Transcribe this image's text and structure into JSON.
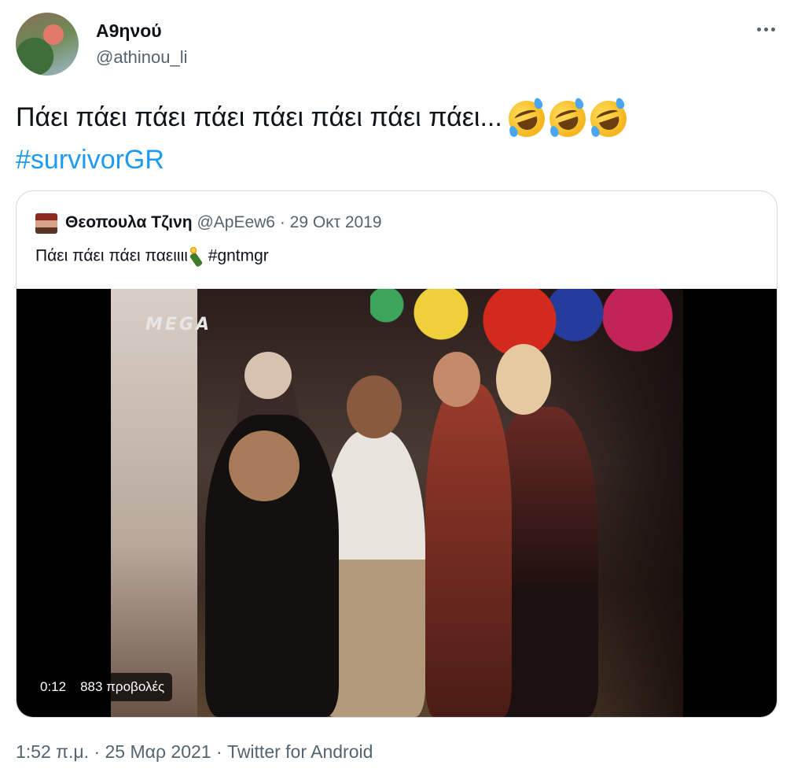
{
  "tweet": {
    "author_name": "Α9ηνού",
    "author_handle": "@athinou_li",
    "text_main": "Πάει πάει πάει πάει πάει πάει πάει πάει...",
    "emoji_name": "rolling-on-the-floor-laughing-emoji",
    "hashtag": "#survivorGR"
  },
  "quoted_tweet": {
    "author_name": "Θεοπουλα Τζινη",
    "author_handle": "@ApEew6",
    "date_separator": " · ",
    "date": "29 Οκτ 2019",
    "text": "Πάει πάει πάει παειιιι",
    "emoji_name": "bottle-with-popping-cork-emoji",
    "hashtag": "#gntmgr",
    "video": {
      "channel_logo": "MEGA",
      "duration": "0:12",
      "views": "883 προβολές"
    }
  },
  "footer": {
    "time": "1:52 π.μ.",
    "separator": " · ",
    "date": "25 Μαρ 2021",
    "source": "Twitter for Android"
  },
  "colors": {
    "link": "#1d9bf0",
    "secondary_text": "#536471",
    "primary_text": "#0f1419",
    "border": "#cfd9de"
  }
}
